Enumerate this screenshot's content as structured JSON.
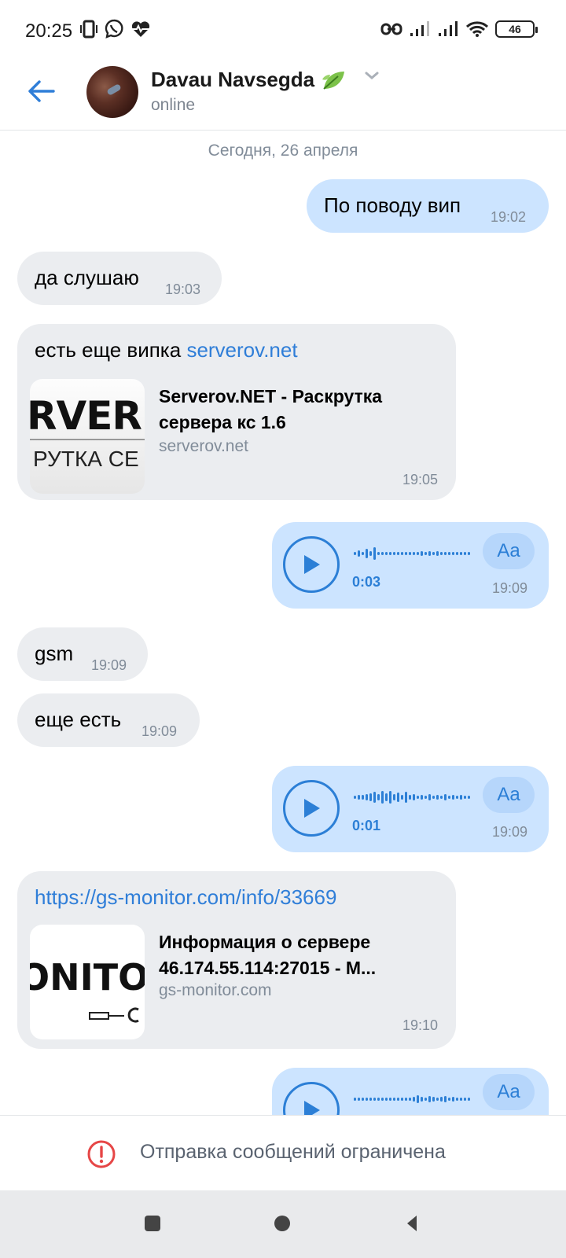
{
  "status_bar": {
    "time": "20:25",
    "battery": "46",
    "icons_left": [
      "vibrate-icon",
      "viber-icon",
      "heartbeat-icon"
    ],
    "icons_right": [
      "link-icon",
      "signal-icon",
      "signal-icon",
      "wifi-icon",
      "battery-icon"
    ]
  },
  "header": {
    "name": "Davau Navsegda",
    "status": "online",
    "colors": {
      "accent": "#2f7ed8"
    }
  },
  "chat": {
    "date_separator": "Сегодня, 26 апреля",
    "messages": [
      {
        "dir": "out",
        "text": "По поводу вип",
        "time": "19:02"
      },
      {
        "dir": "in",
        "text": "да слушаю",
        "time": "19:03"
      },
      {
        "dir": "in",
        "text": "есть еще випка ",
        "link": "serverov.net",
        "time": "19:05",
        "preview": {
          "image_text_1": "RVER",
          "image_text_2": "РУТКА СЕ",
          "title": "Serverov.NET - Раскрутка сервера кс 1.6",
          "domain": "serverov.net"
        }
      },
      {
        "dir": "out",
        "type": "voice",
        "duration": "0:03",
        "transcribe": "Aa",
        "time": "19:09"
      },
      {
        "dir": "in",
        "text": "gsm",
        "time": "19:09"
      },
      {
        "dir": "in",
        "text": "еще есть",
        "time": "19:09"
      },
      {
        "dir": "out",
        "type": "voice",
        "duration": "0:01",
        "transcribe": "Aa",
        "time": "19:09"
      },
      {
        "dir": "in",
        "link": "https://gs-monitor.com/info/33669",
        "time": "19:10",
        "preview": {
          "image_text_1": "ONITO",
          "title": "Информация о сервере 46.174.55.114:27015 - M...",
          "domain": "gs-monitor.com"
        }
      },
      {
        "dir": "out",
        "type": "voice",
        "transcribe": "Aa"
      }
    ]
  },
  "footer": {
    "restricted_text": "Отправка сообщений ограничена"
  }
}
